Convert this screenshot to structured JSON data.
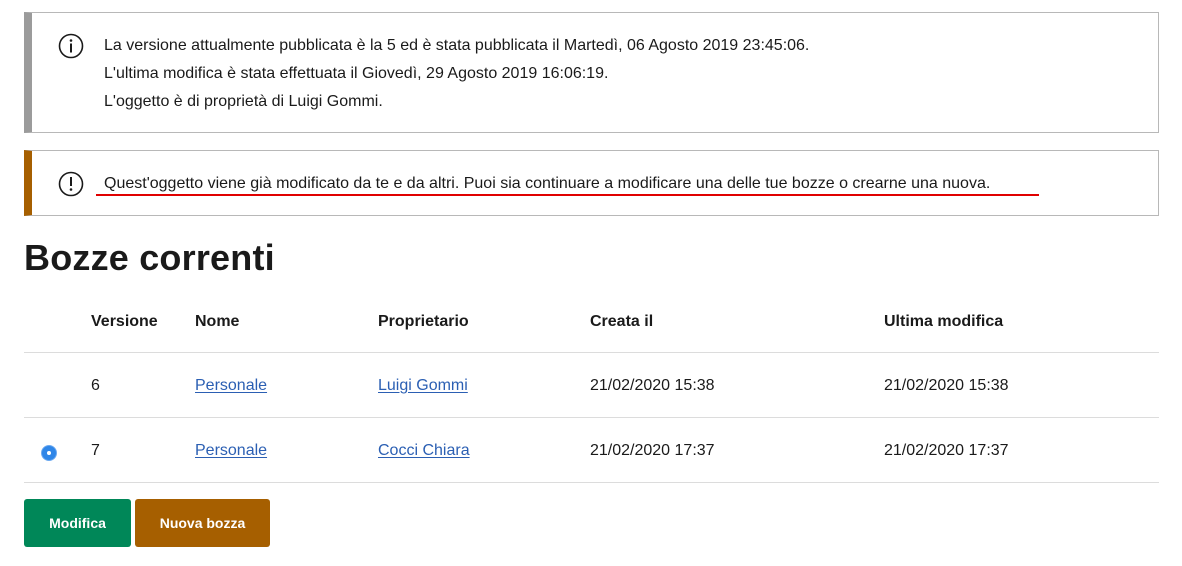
{
  "info_alert": {
    "lines": [
      "La versione attualmente pubblicata è la 5 ed è stata pubblicata il Martedì, 06 Agosto 2019 23:45:06.",
      "L'ultima modifica è stata effettuata il Giovedì, 29 Agosto 2019 16:06:19.",
      "L'oggetto è di proprietà di Luigi Gommi."
    ],
    "icon": "info-icon"
  },
  "warning_alert": {
    "text": "Quest'oggetto viene già modificato da te e da altri. Puoi sia continuare a modificare una delle tue bozze o crearne una nuova.",
    "icon": "exclamation-icon"
  },
  "page_title": "Bozze correnti",
  "table": {
    "headers": [
      "Versione",
      "Nome",
      "Proprietario",
      "Creata il",
      "Ultima modifica"
    ],
    "rows": [
      {
        "selected": false,
        "versione": "6",
        "nome": "Personale",
        "proprietario": "Luigi Gommi",
        "creata_il": "21/02/2020 15:38",
        "ultima_modifica": "21/02/2020 15:38"
      },
      {
        "selected": true,
        "versione": "7",
        "nome": "Personale",
        "proprietario": "Cocci Chiara",
        "creata_il": "21/02/2020 17:37",
        "ultima_modifica": "21/02/2020 17:37"
      }
    ]
  },
  "buttons": {
    "modifica": "Modifica",
    "nuova_bozza": "Nuova bozza"
  },
  "colors": {
    "primary_green": "#008758",
    "warning_brown": "#a65f00",
    "link_blue": "#2b5fb3",
    "radio_blue": "#2f86e8",
    "annotation_red": "#e00000",
    "info_border_gray": "#9b9b9b"
  }
}
